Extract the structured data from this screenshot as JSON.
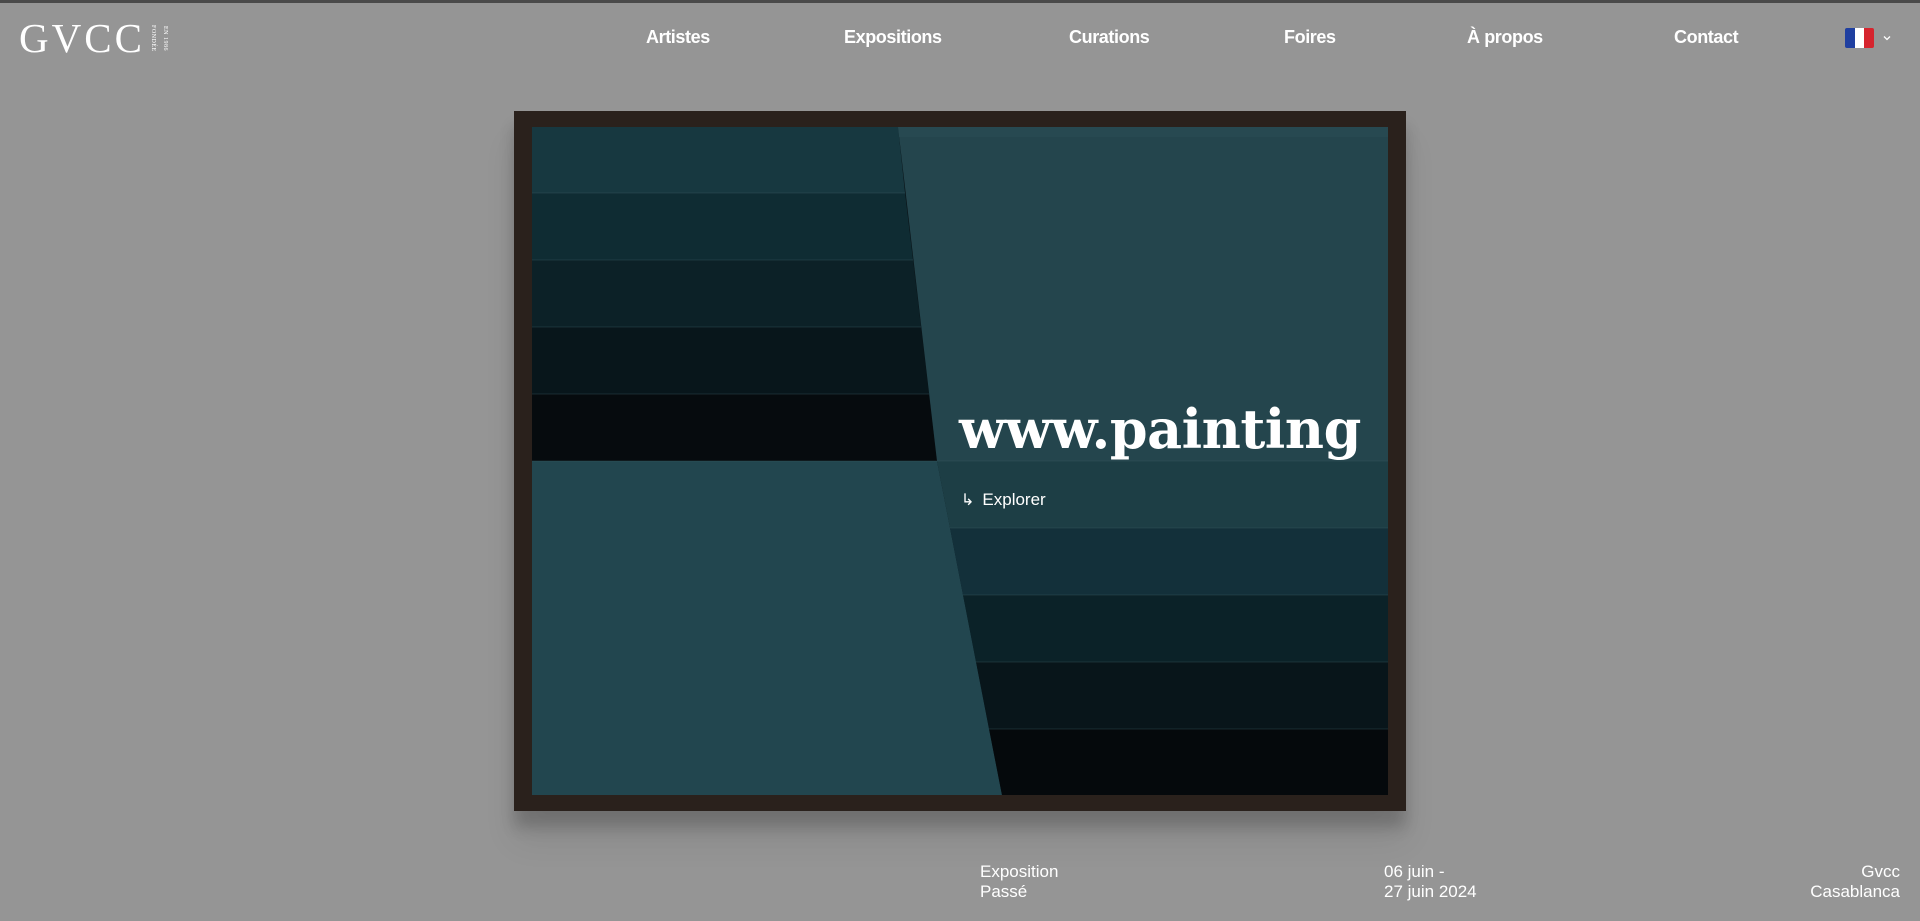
{
  "brand": {
    "name": "GVCC",
    "tagline_1": "FONDÉE",
    "tagline_2": "EN 1986"
  },
  "nav": {
    "items": [
      {
        "label": "Artistes"
      },
      {
        "label": "Expositions"
      },
      {
        "label": "Curations"
      },
      {
        "label": "Foires"
      },
      {
        "label": "À propos"
      },
      {
        "label": "Contact"
      }
    ]
  },
  "language": {
    "icon": "flag-france-icon",
    "flag_colors": [
      "#1f3fa0",
      "#ffffff",
      "#d6242e"
    ]
  },
  "hero": {
    "title": "www.painting",
    "cta_icon": "return-arrow-icon",
    "cta_glyph": "↳",
    "cta_label": "Explorer"
  },
  "details": {
    "type_line_1": "Exposition",
    "type_line_2": "Passé",
    "date_line_1": "06 juin -",
    "date_line_2": "27 juin 2024",
    "venue_line_1": "Gvcc",
    "venue_line_2": "Casablanca"
  },
  "colors": {
    "background": "#959595",
    "frame": "#2a211c",
    "text": "#ffffff"
  }
}
